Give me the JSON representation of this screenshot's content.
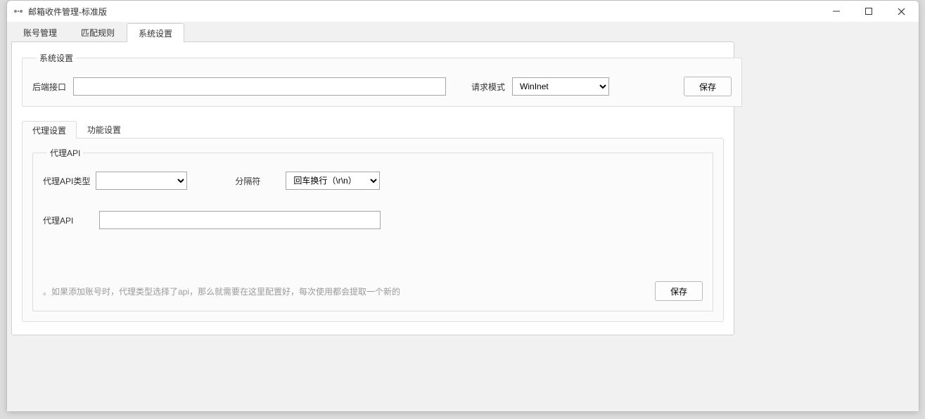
{
  "window": {
    "title": "邮箱收件管理-标准版"
  },
  "main_tabs": {
    "items": [
      {
        "label": "账号管理"
      },
      {
        "label": "匹配规则"
      },
      {
        "label": "系统设置"
      }
    ]
  },
  "system_group": {
    "legend": "系统设置",
    "backend_label": "后端接口",
    "backend_value": "",
    "request_mode_label": "请求模式",
    "request_mode_value": "WinInet",
    "save_label": "保存"
  },
  "inner_tabs": {
    "items": [
      {
        "label": "代理设置"
      },
      {
        "label": "功能设置"
      }
    ]
  },
  "proxy_group": {
    "legend": "代理API",
    "api_type_label": "代理API类型",
    "api_type_value": "",
    "delimiter_label": "分隔符",
    "delimiter_value": "回车换行（\\r\\n）",
    "proxy_api_label": "代理API",
    "proxy_api_value": "",
    "hint": "。如果添加账号时，代理类型选择了api，那么就需要在这里配置好，每次使用都会提取一个新的",
    "save_label": "保存"
  }
}
